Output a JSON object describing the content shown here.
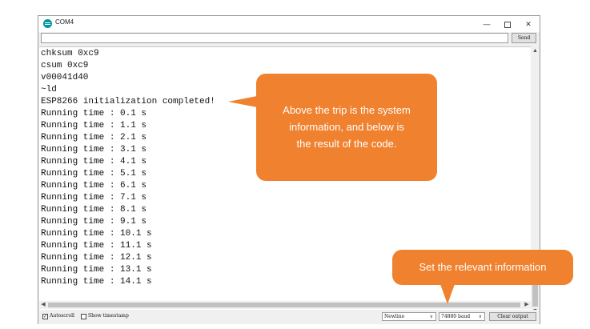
{
  "window": {
    "title": "COM4",
    "icon": "arduino-icon",
    "controls": {
      "minimize": "—",
      "maximize": "",
      "close": "✕"
    }
  },
  "send_bar": {
    "input_value": "",
    "send_label": "Send"
  },
  "output_lines": [
    "chksum 0xc9",
    "csum 0xc9",
    "v00041d40",
    "~ld",
    "ESP8266 initialization completed!",
    "Running time : 0.1 s",
    "Running time : 1.1 s",
    "Running time : 2.1 s",
    "Running time : 3.1 s",
    "Running time : 4.1 s",
    "Running time : 5.1 s",
    "Running time : 6.1 s",
    "Running time : 7.1 s",
    "Running time : 8.1 s",
    "Running time : 9.1 s",
    "Running time : 10.1 s",
    "Running time : 11.1 s",
    "Running time : 12.1 s",
    "Running time : 13.1 s",
    "Running time : 14.1 s"
  ],
  "bottom_bar": {
    "autoscroll_label": "Autoscroll",
    "autoscroll_checked": true,
    "timestamp_label": "Show timestamp",
    "timestamp_checked": false,
    "line_ending": "Newline",
    "baud_rate": "74880 baud",
    "clear_label": "Clear output"
  },
  "annotations": {
    "main_lines": [
      "Above the trip is the system",
      "information, and below is",
      "the result of the code."
    ],
    "settings": "Set the relevant information",
    "color": "#f0812e"
  },
  "colors": {
    "arduino_teal": "#00979c",
    "window_bg": "#f0f0f0"
  }
}
